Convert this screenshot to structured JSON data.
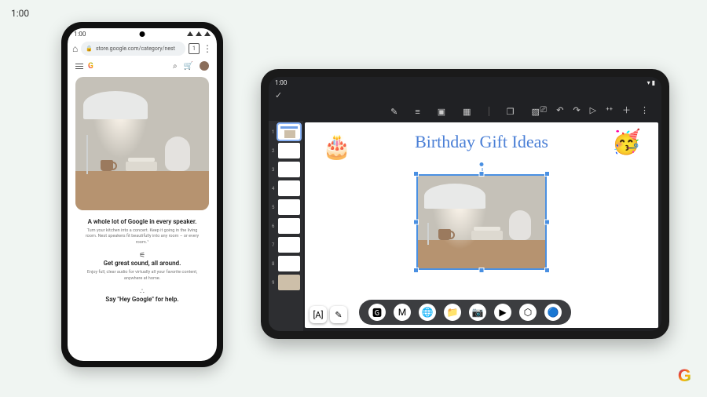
{
  "outer_time": "1:00",
  "phone": {
    "status_time": "1:00",
    "url": "store.google.com/category/nest",
    "tab_count": "1",
    "headline1": "A whole lot of Google in every speaker.",
    "para1": "Turn your kitchen into a concert. Keep it going in the living room. Nest speakers fit beautifully into any room – or every room.¹",
    "headline2": "Get great sound, all around.",
    "para2": "Enjoy full, clear audio for virtually all your favorite content, anywhere at home.",
    "headline3": "Say \"Hey Google\" for help."
  },
  "tablet": {
    "status_time": "1:00",
    "slide_title": "Birthday Gift Ideas",
    "emoji_cake": "🎂",
    "emoji_party": "🥳",
    "thumb_count": 9,
    "selected_thumb": 1,
    "toolbar_icons": {
      "draw": "✎",
      "menu": "≡",
      "crop": "▣",
      "image": "▦",
      "copy": "❐",
      "layers": "▧",
      "cast": "⎚",
      "undo": "↶",
      "redo": "↷",
      "play": "▷",
      "share": "⁺⁺",
      "add": "＋",
      "more": "⋮"
    },
    "float_tools": {
      "text": "[A]",
      "pen": "✎"
    },
    "taskbar": [
      "🅶",
      "M",
      "🌐",
      "📁",
      "📷",
      "▶",
      "⬡",
      "🔵"
    ]
  }
}
